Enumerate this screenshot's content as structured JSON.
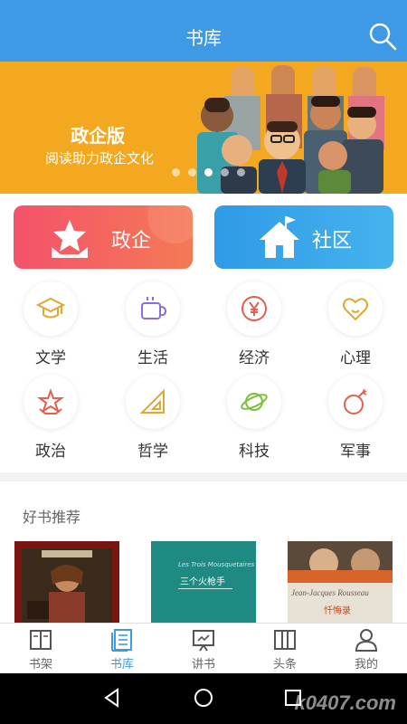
{
  "header": {
    "title": "书库"
  },
  "banner": {
    "title": "政企版",
    "subtitle": "阅读助力政企文化",
    "dot_count": 5,
    "active_dot": 2
  },
  "quick_buttons": [
    {
      "label": "政企",
      "color": "#f4526a"
    },
    {
      "label": "社区",
      "color": "#2f9ae6"
    }
  ],
  "categories": [
    {
      "label": "文学",
      "icon": "graduation-cap-icon"
    },
    {
      "label": "生活",
      "icon": "coffee-cup-icon"
    },
    {
      "label": "经济",
      "icon": "yen-coin-icon"
    },
    {
      "label": "心理",
      "icon": "heart-icon"
    },
    {
      "label": "政治",
      "icon": "star-icon"
    },
    {
      "label": "哲学",
      "icon": "triangle-ruler-icon"
    },
    {
      "label": "科技",
      "icon": "planet-icon"
    },
    {
      "label": "军事",
      "icon": "bomb-icon"
    }
  ],
  "recommend": {
    "title": "好书推荐",
    "books": [
      {
        "cover": "painting-cover"
      },
      {
        "cover_text": "三个火枪手",
        "cover_subtitle": "Les Trois Mousquetaires"
      },
      {
        "cover_text": "忏悔录",
        "cover_subtitle": "Jean-Jacques Rousseau"
      }
    ]
  },
  "tabs": [
    {
      "label": "书架",
      "icon": "bookshelf-icon",
      "active": false
    },
    {
      "label": "书库",
      "icon": "library-icon",
      "active": true
    },
    {
      "label": "讲书",
      "icon": "presentation-icon",
      "active": false
    },
    {
      "label": "头条",
      "icon": "news-icon",
      "active": false
    },
    {
      "label": "我的",
      "icon": "profile-icon",
      "active": false
    }
  ],
  "watermark": "k0407.com",
  "colors": {
    "primary": "#3f9ae6",
    "banner": "#f4a81f"
  }
}
